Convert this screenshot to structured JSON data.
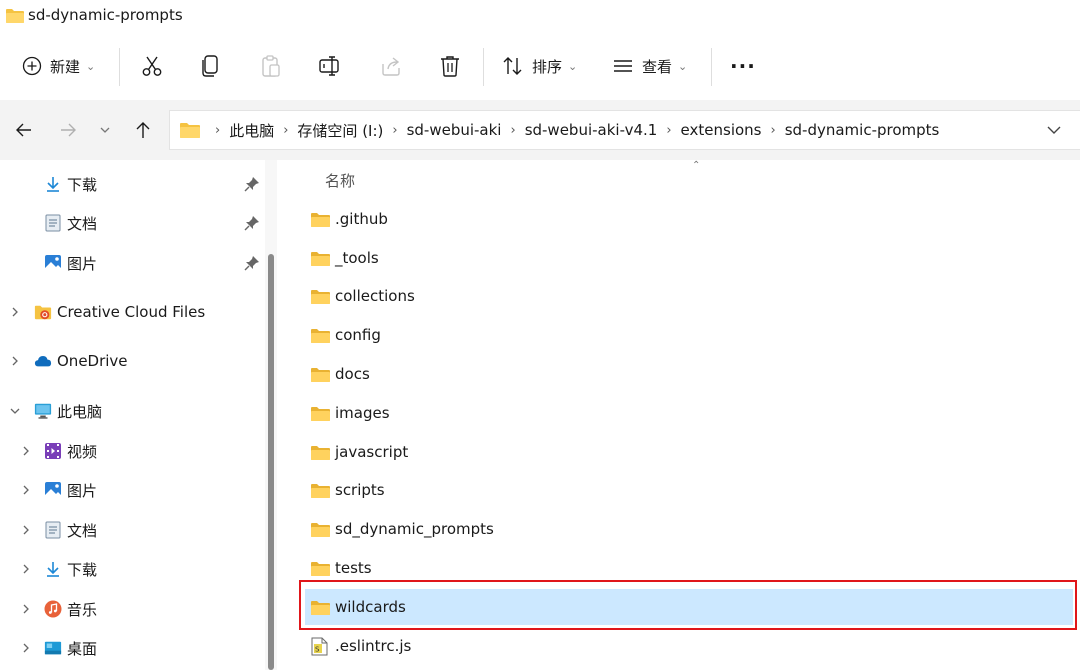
{
  "window": {
    "title": "sd-dynamic-prompts"
  },
  "toolbar": {
    "new_label": "新建",
    "cut_icon": "scissors-icon",
    "copy_icon": "copy-icon",
    "paste_icon": "paste-icon",
    "rename_icon": "rename-icon",
    "share_icon": "share-icon",
    "delete_icon": "trash-icon",
    "sort_label": "排序",
    "view_label": "查看",
    "more_label": "···"
  },
  "breadcrumbs": [
    "此电脑",
    "存储空间 (I:)",
    "sd-webui-aki",
    "sd-webui-aki-v4.1",
    "extensions",
    "sd-dynamic-prompts"
  ],
  "sidebar": {
    "quick_access": [
      {
        "label": "下载",
        "icon": "download-icon"
      },
      {
        "label": "文档",
        "icon": "document-icon"
      },
      {
        "label": "图片",
        "icon": "picture-icon"
      }
    ],
    "creative_cloud": "Creative Cloud Files",
    "onedrive": "OneDrive",
    "this_pc": "此电脑",
    "pc_items": [
      {
        "label": "视频",
        "icon": "video-icon"
      },
      {
        "label": "图片",
        "icon": "picture-icon"
      },
      {
        "label": "文档",
        "icon": "document-icon"
      },
      {
        "label": "下载",
        "icon": "download-icon"
      },
      {
        "label": "音乐",
        "icon": "music-icon"
      },
      {
        "label": "桌面",
        "icon": "desktop-icon"
      }
    ]
  },
  "file_list": {
    "column_name": "名称",
    "items": [
      {
        "name": ".github",
        "type": "folder"
      },
      {
        "name": "_tools",
        "type": "folder"
      },
      {
        "name": "collections",
        "type": "folder"
      },
      {
        "name": "config",
        "type": "folder"
      },
      {
        "name": "docs",
        "type": "folder"
      },
      {
        "name": "images",
        "type": "folder"
      },
      {
        "name": "javascript",
        "type": "folder"
      },
      {
        "name": "scripts",
        "type": "folder"
      },
      {
        "name": "sd_dynamic_prompts",
        "type": "folder"
      },
      {
        "name": "tests",
        "type": "folder"
      },
      {
        "name": "wildcards",
        "type": "folder",
        "selected": true
      },
      {
        "name": ".eslintrc.js",
        "type": "js-file"
      }
    ]
  },
  "colors": {
    "folder": "#f5c342",
    "selection": "#cce8ff",
    "highlight_box": "#e0161a",
    "accent": "#0a64c8"
  }
}
